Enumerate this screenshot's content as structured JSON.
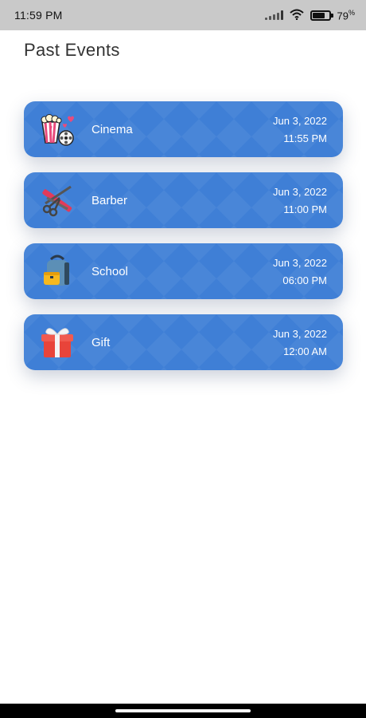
{
  "status_bar": {
    "time": "11:59 PM",
    "battery_text": "79",
    "battery_unit": "%",
    "battery_level": 0.79,
    "icons": [
      "signal-icon",
      "wifi-icon",
      "battery-icon"
    ]
  },
  "page": {
    "title": "Past Events"
  },
  "events": [
    {
      "name": "Cinema",
      "date": "Jun 3, 2022",
      "time": "11:55 PM",
      "icon": "popcorn-film-icon"
    },
    {
      "name": "Barber",
      "date": "Jun 3, 2022",
      "time": "11:00 PM",
      "icon": "scissors-comb-icon"
    },
    {
      "name": "School",
      "date": "Jun 3, 2022",
      "time": "06:00 PM",
      "icon": "backpack-icon"
    },
    {
      "name": "Gift",
      "date": "Jun 3, 2022",
      "time": "12:00 AM",
      "icon": "gift-box-icon"
    }
  ],
  "colors": {
    "card": "#3f7fd6",
    "status_bar": "#c9c9c9",
    "title": "#333333"
  }
}
